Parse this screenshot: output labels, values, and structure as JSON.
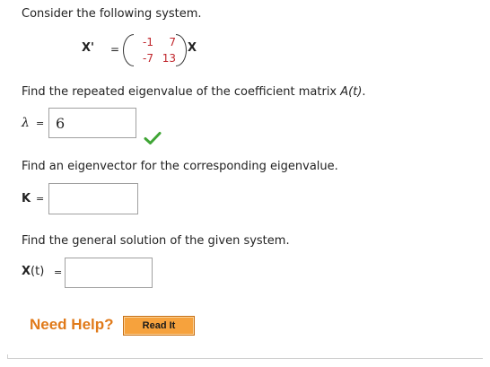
{
  "intro": "Consider the following system.",
  "system": {
    "lhs": "X'",
    "equals": "=",
    "matrix": [
      [
        "-1",
        "7"
      ],
      [
        "-7",
        "13"
      ]
    ],
    "rhs": "X"
  },
  "q1": {
    "prompt_pre": "Find the repeated eigenvalue of the coefficient matrix ",
    "prompt_math": "A(t)",
    "prompt_post": ".",
    "label": "λ",
    "equals": "=",
    "answer": "6",
    "status": "correct"
  },
  "q2": {
    "prompt": "Find an eigenvector for the corresponding eigenvalue.",
    "label": "K",
    "equals": "=",
    "answer": ""
  },
  "q3": {
    "prompt": "Find the general solution of the given system.",
    "label_bold": "X",
    "label_rest": "(t)",
    "equals": "=",
    "answer": ""
  },
  "help": {
    "text": "Need Help?",
    "button": "Read It"
  },
  "colors": {
    "matrix_entries": "#c0262c",
    "check": "#3fa535",
    "help_text": "#e07a1a",
    "button_fill": "#f6a23d"
  }
}
